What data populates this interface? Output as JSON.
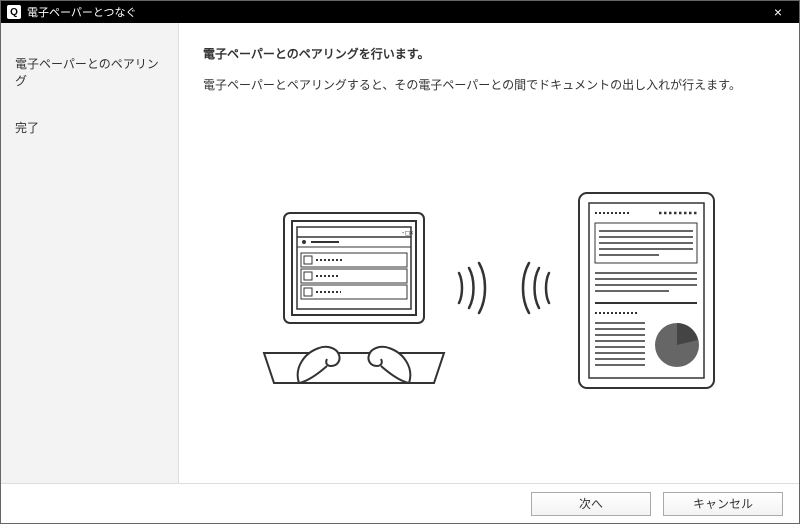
{
  "titlebar": {
    "icon_letter": "Q",
    "title": "電子ペーパーとつなぐ",
    "close_glyph": "×"
  },
  "sidebar": {
    "items": [
      {
        "label": "電子ペーパーとのペアリング"
      },
      {
        "label": "完了"
      }
    ]
  },
  "main": {
    "heading": "電子ペーパーとのペアリングを行います。",
    "description": "電子ペーパーとペアリングすると、その電子ペーパーとの間でドキュメントの出し入れが行えます。"
  },
  "footer": {
    "next_label": "次へ",
    "cancel_label": "キャンセル"
  }
}
